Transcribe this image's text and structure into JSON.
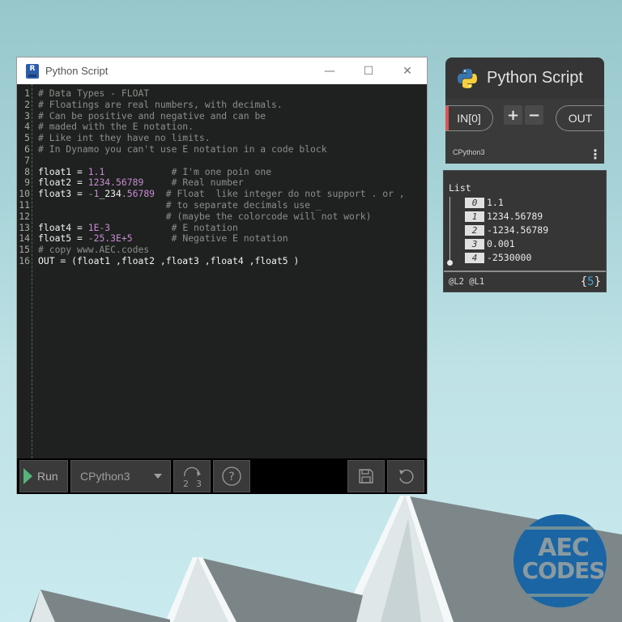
{
  "window": {
    "title": "Python Script",
    "app_icon_letter": "R",
    "controls": {
      "minimize": "—",
      "maximize": "☐",
      "close": "✕"
    }
  },
  "code": {
    "lines": [
      {
        "n": "1",
        "tokens": [
          {
            "t": "comment",
            "v": "# Data Types - FLOAT"
          }
        ]
      },
      {
        "n": "2",
        "tokens": [
          {
            "t": "comment",
            "v": "# Floatings are real numbers, with decimals."
          }
        ]
      },
      {
        "n": "3",
        "tokens": [
          {
            "t": "comment",
            "v": "# Can be positive and negative and can be"
          }
        ]
      },
      {
        "n": "4",
        "tokens": [
          {
            "t": "comment",
            "v": "# maded with the E notation."
          }
        ]
      },
      {
        "n": "5",
        "tokens": [
          {
            "t": "comment",
            "v": "# Like int they have no limits."
          }
        ]
      },
      {
        "n": "6",
        "tokens": [
          {
            "t": "comment",
            "v": "# In Dynamo you can't use E notation in a code block"
          }
        ]
      },
      {
        "n": "7",
        "tokens": []
      },
      {
        "n": "8",
        "tokens": [
          {
            "t": "plain",
            "v": "float1 = "
          },
          {
            "t": "num",
            "v": "1.1"
          },
          {
            "t": "plain",
            "v": "            "
          },
          {
            "t": "comment",
            "v": "# I'm one poin one"
          }
        ]
      },
      {
        "n": "9",
        "tokens": [
          {
            "t": "plain",
            "v": "float2 = "
          },
          {
            "t": "num",
            "v": "1234.56789"
          },
          {
            "t": "plain",
            "v": "     "
          },
          {
            "t": "comment",
            "v": "# Real number"
          }
        ]
      },
      {
        "n": "10",
        "tokens": [
          {
            "t": "plain",
            "v": "float3 = "
          },
          {
            "t": "num",
            "v": "-1"
          },
          {
            "t": "plain",
            "v": "_234"
          },
          {
            "t": "num",
            "v": ".56789"
          },
          {
            "t": "plain",
            "v": "  "
          },
          {
            "t": "comment",
            "v": "# Float  like integer do not support . or ,"
          }
        ]
      },
      {
        "n": "11",
        "tokens": [
          {
            "t": "plain",
            "v": "                       "
          },
          {
            "t": "comment",
            "v": "# to separate decimals use _"
          }
        ]
      },
      {
        "n": "12",
        "tokens": [
          {
            "t": "plain",
            "v": "                       "
          },
          {
            "t": "comment",
            "v": "# (maybe the colorcode will not work)"
          }
        ]
      },
      {
        "n": "13",
        "tokens": [
          {
            "t": "plain",
            "v": "float4 = "
          },
          {
            "t": "num",
            "v": "1E-3"
          },
          {
            "t": "plain",
            "v": "           "
          },
          {
            "t": "comment",
            "v": "# E notation"
          }
        ]
      },
      {
        "n": "14",
        "tokens": [
          {
            "t": "plain",
            "v": "float5 = "
          },
          {
            "t": "num",
            "v": "-25.3E+5"
          },
          {
            "t": "plain",
            "v": "       "
          },
          {
            "t": "comment",
            "v": "# Negative E notation"
          }
        ]
      },
      {
        "n": "15",
        "tokens": [
          {
            "t": "comment",
            "v": "# copy www.AEC.codes"
          }
        ]
      },
      {
        "n": "16",
        "tokens": [
          {
            "t": "plain",
            "v": "OUT = (float1 ,float2 ,float3 ,float4 ,float5 )"
          }
        ]
      }
    ]
  },
  "toolbar": {
    "run_label": "Run",
    "engine_selected": "CPython3",
    "convert_icon_text": [
      "2",
      "3"
    ],
    "help_icon_text": "?"
  },
  "node": {
    "title": "Python Script",
    "input_port": "IN[0]",
    "add_port": "+",
    "remove_port": "−",
    "output_port": "OUT",
    "engine": "CPython3",
    "menu_icon": "⋮"
  },
  "preview": {
    "header": "List",
    "items": [
      {
        "index": "0",
        "value": "1.1"
      },
      {
        "index": "1",
        "value": "1234.56789"
      },
      {
        "index": "2",
        "value": "-1234.56789"
      },
      {
        "index": "3",
        "value": "0.001"
      },
      {
        "index": "4",
        "value": "-2530000"
      }
    ],
    "levels": "@L2 @L1",
    "count_open": "{",
    "count": "5",
    "count_close": "}"
  },
  "logo": {
    "line1": "AEC",
    "line2": "CODES"
  },
  "colors": {
    "accent_run": "#56b47a",
    "number_token": "#c88bd3",
    "comment_token": "#8c8e8a",
    "input_port_marker": "#e05151",
    "count_highlight": "#3ea2e0",
    "logo_blue": "#1b65a4"
  }
}
